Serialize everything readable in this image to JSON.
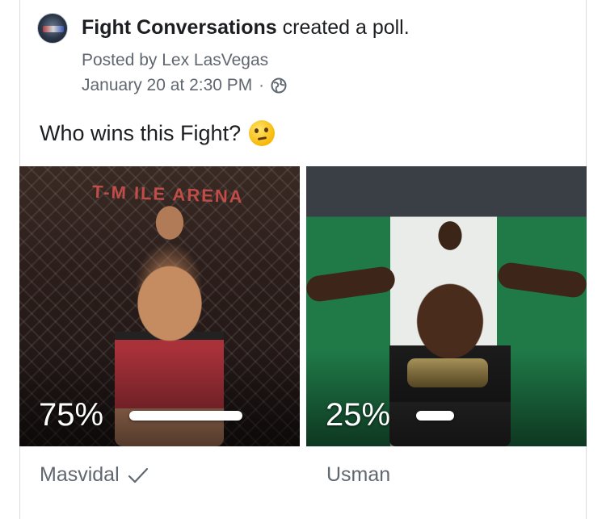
{
  "post": {
    "page_name": "Fight Conversations",
    "action_text": "created a poll.",
    "posted_by": "Posted by Lex LasVegas",
    "timestamp": "January 20 at 2:30 PM",
    "separator": "·",
    "question": "Who wins this Fight?"
  },
  "poll": {
    "options": [
      {
        "name": "Masvidal",
        "percent_text": "75%",
        "percent": 75,
        "selected": true,
        "banner_text": "T-M ILE ARENA"
      },
      {
        "name": "Usman",
        "percent_text": "25%",
        "percent": 25,
        "selected": false
      }
    ]
  },
  "icons": {
    "globe": "globe-icon",
    "emoji": "thinking-face-emoji",
    "check": "checkmark-icon"
  },
  "colors": {
    "text_primary": "#1c1e21",
    "text_secondary": "#606770",
    "flag_green": "#1f7a48",
    "shorts_red": "#a8313a"
  }
}
